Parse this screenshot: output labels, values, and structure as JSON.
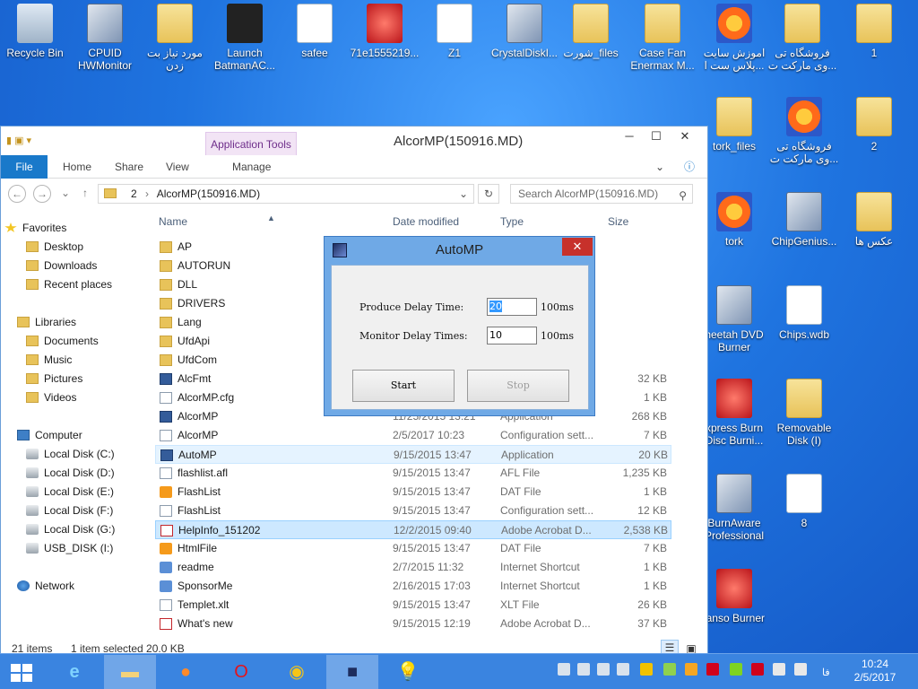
{
  "desktop": {
    "top_icons": [
      {
        "label": "Recycle Bin"
      },
      {
        "label": "CPUID HWMonitor"
      },
      {
        "label": "مورد نیاز بت زدن"
      },
      {
        "label": "Launch BatmanAC..."
      },
      {
        "label": "safee"
      },
      {
        "label": "71e1555219..."
      },
      {
        "label": "Z1"
      },
      {
        "label": "CrystalDiskI..."
      },
      {
        "label": "شورت_files"
      },
      {
        "label": "Case Fan Enermax M..."
      },
      {
        "label": "اموزش سایت پلاس ست ا..."
      },
      {
        "label": "فروشگاه تی وی مارکت ت..."
      },
      {
        "label": "1"
      }
    ],
    "right_icons": [
      {
        "label": "tork_files"
      },
      {
        "label": "فروشگاه تی وی مارکت ت..."
      },
      {
        "label": "2"
      },
      {
        "label": "tork"
      },
      {
        "label": "ChipGenius..."
      },
      {
        "label": "عکس ها"
      },
      {
        "label": "heetah DVD Burner"
      },
      {
        "label": "Chips.wdb"
      },
      {
        "label": "xpress Burn Disc Burni..."
      },
      {
        "label": "Removable Disk (I)"
      },
      {
        "label": "BurnAware Professional"
      },
      {
        "label": "8"
      },
      {
        "label": "ianso Burner"
      }
    ]
  },
  "explorer": {
    "title": "AlcorMP(150916.MD)",
    "tools_tab": "Application Tools",
    "ribbon_tabs": [
      "File",
      "Home",
      "Share",
      "View",
      "Manage"
    ],
    "address": {
      "prefix": "2",
      "path": "AlcorMP(150916.MD)"
    },
    "search_placeholder": "Search AlcorMP(150916.MD)",
    "columns": {
      "name": "Name",
      "date": "Date modified",
      "type": "Type",
      "size": "Size"
    },
    "nav": {
      "favorites": "Favorites",
      "desktop": "Desktop",
      "downloads": "Downloads",
      "recent": "Recent places",
      "libraries": "Libraries",
      "documents": "Documents",
      "music": "Music",
      "pictures": "Pictures",
      "videos": "Videos",
      "computer": "Computer",
      "drive_c": "Local Disk (C:)",
      "drive_d": "Local Disk (D:)",
      "drive_e": "Local Disk (E:)",
      "drive_f": "Local Disk (F:)",
      "drive_g": "Local Disk (G:)",
      "drive_i": "USB_DISK (I:)",
      "network": "Network"
    },
    "files": [
      {
        "name": "AP",
        "date": "",
        "type": "",
        "size": "",
        "icon": "folder"
      },
      {
        "name": "AUTORUN",
        "date": "",
        "type": "",
        "size": "",
        "icon": "folder"
      },
      {
        "name": "DLL",
        "date": "",
        "type": "",
        "size": "",
        "icon": "folder"
      },
      {
        "name": "DRIVERS",
        "date": "",
        "type": "",
        "size": "",
        "icon": "folder"
      },
      {
        "name": "Lang",
        "date": "",
        "type": "",
        "size": "",
        "icon": "folder"
      },
      {
        "name": "UfdApi",
        "date": "",
        "type": "",
        "size": "",
        "icon": "folder"
      },
      {
        "name": "UfdCom",
        "date": "",
        "type": "",
        "size": "",
        "icon": "folder"
      },
      {
        "name": "AlcFmt",
        "date": "",
        "type": "",
        "size": "32 KB",
        "icon": "app"
      },
      {
        "name": "AlcorMP.cfg",
        "date": "",
        "type": "",
        "size": "1 KB",
        "icon": "file"
      },
      {
        "name": "AlcorMP",
        "date": "11/25/2015 13:21",
        "type": "Application",
        "size": "268 KB",
        "icon": "app"
      },
      {
        "name": "AlcorMP",
        "date": "2/5/2017 10:23",
        "type": "Configuration sett...",
        "size": "7 KB",
        "icon": "file"
      },
      {
        "name": "AutoMP",
        "date": "9/15/2015 13:47",
        "type": "Application",
        "size": "20 KB",
        "icon": "app"
      },
      {
        "name": "flashlist.afl",
        "date": "9/15/2015 13:47",
        "type": "AFL File",
        "size": "1,235 KB",
        "icon": "file"
      },
      {
        "name": "FlashList",
        "date": "9/15/2015 13:47",
        "type": "DAT File",
        "size": "1 KB",
        "icon": "media"
      },
      {
        "name": "FlashList",
        "date": "9/15/2015 13:47",
        "type": "Configuration sett...",
        "size": "12 KB",
        "icon": "file"
      },
      {
        "name": "HelpInfo_151202",
        "date": "12/2/2015 09:40",
        "type": "Adobe Acrobat D...",
        "size": "2,538 KB",
        "icon": "pdf"
      },
      {
        "name": "HtmlFile",
        "date": "9/15/2015 13:47",
        "type": "DAT File",
        "size": "7 KB",
        "icon": "media"
      },
      {
        "name": "readme",
        "date": "2/7/2015 11:32",
        "type": "Internet Shortcut",
        "size": "1 KB",
        "icon": "link"
      },
      {
        "name": "SponsorMe",
        "date": "2/16/2015 17:03",
        "type": "Internet Shortcut",
        "size": "1 KB",
        "icon": "link"
      },
      {
        "name": "Templet.xlt",
        "date": "9/15/2015 13:47",
        "type": "XLT File",
        "size": "26 KB",
        "icon": "file"
      },
      {
        "name": "What's new",
        "date": "9/15/2015 12:19",
        "type": "Adobe Acrobat D...",
        "size": "37 KB",
        "icon": "pdf"
      }
    ],
    "status": {
      "count": "21 items",
      "selected": "1 item selected  20.0 KB"
    }
  },
  "dialog": {
    "title": "AutoMP",
    "produce_label": "Produce Delay Time:",
    "produce_value": "20",
    "monitor_label": "Monitor Delay Times:",
    "monitor_value": "10",
    "unit": "100ms",
    "start_label": "Start",
    "stop_label": "Stop"
  },
  "taskbar": {
    "lang": "فا",
    "time": "10:24",
    "date": "2/5/2017"
  }
}
